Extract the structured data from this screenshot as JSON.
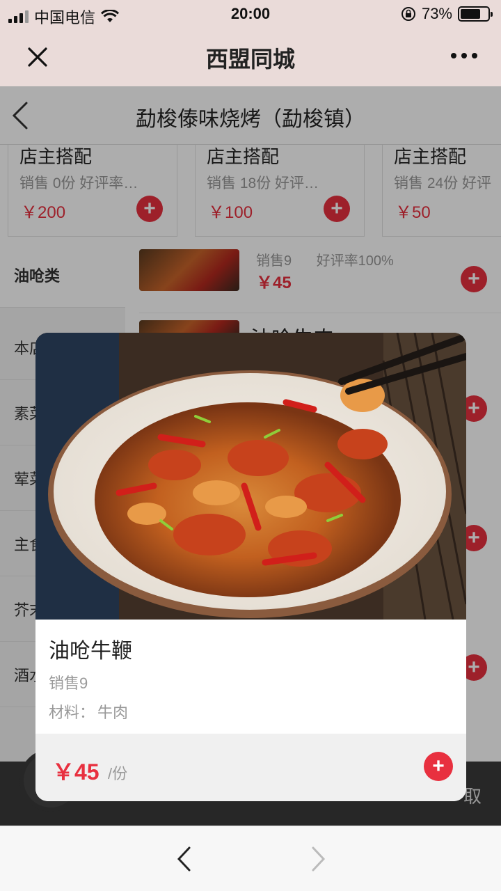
{
  "status": {
    "carrier": "中国电信",
    "time": "20:00",
    "battery": "73%",
    "battery_level": 0.73
  },
  "nav": {
    "title": "西盟同城",
    "close_icon": "close-icon",
    "more_icon": "more-icon"
  },
  "header": {
    "title": "勐梭傣味烧烤（勐梭镇）",
    "back_icon": "chevron-left-icon"
  },
  "combos": [
    {
      "title": "店主搭配",
      "stats": "销售  0份  好评率…",
      "price": "￥200"
    },
    {
      "title": "店主搭配",
      "stats": "销售  18份  好评…",
      "price": "￥100"
    },
    {
      "title": "店主搭配",
      "stats": "销售  24份  好评",
      "price": "￥50"
    }
  ],
  "sidebar": {
    "items": [
      {
        "label": "油呛类"
      },
      {
        "label": "本店"
      },
      {
        "label": "素菜"
      },
      {
        "label": "荤菜"
      },
      {
        "label": "主食"
      },
      {
        "label": "芥末"
      },
      {
        "label": "酒水"
      }
    ]
  },
  "dish_list": {
    "first_sales": "销售9",
    "first_rating": "好评率100%",
    "first_price": "￥45",
    "second_name_peek": "油呛牛肉"
  },
  "cart": {
    "action_partial": "取"
  },
  "modal": {
    "name": "油呛牛鞭",
    "sales": "销售9",
    "material_label": "材料：",
    "material_value": "牛肉",
    "price": "￥45",
    "unit": "/份",
    "add_icon": "plus-icon"
  },
  "browser": {
    "back_icon": "chevron-left-icon",
    "forward_icon": "chevron-right-icon"
  },
  "colors": {
    "accent": "#e8303f",
    "status_bg": "#eadbd9"
  }
}
